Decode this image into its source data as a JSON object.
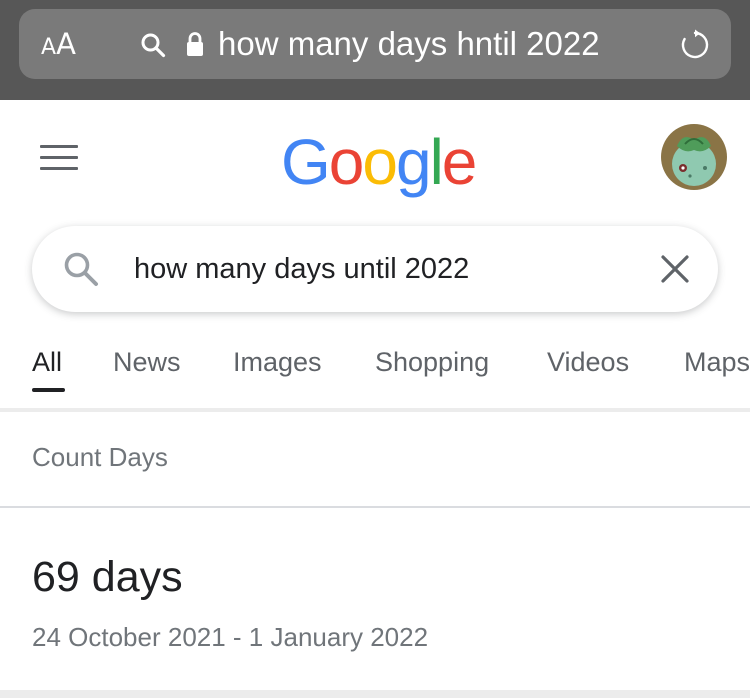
{
  "browser": {
    "aa_small": "A",
    "aa_big": "A",
    "url_text": "how many days hntil 2022"
  },
  "header": {
    "logo": [
      "G",
      "o",
      "o",
      "g",
      "l",
      "e"
    ],
    "logo_colors": [
      "#4285F4",
      "#EA4335",
      "#FBBC05",
      "#4285F4",
      "#34A853",
      "#EA4335"
    ]
  },
  "search": {
    "query": "how many days until 2022"
  },
  "tabs": [
    {
      "label": "All",
      "active": true
    },
    {
      "label": "News",
      "active": false
    },
    {
      "label": "Images",
      "active": false
    },
    {
      "label": "Shopping",
      "active": false
    },
    {
      "label": "Videos",
      "active": false
    },
    {
      "label": "Maps",
      "active": false
    }
  ],
  "result": {
    "header": "Count Days",
    "value": "69 days",
    "range": "24 October 2021 - 1 January 2022"
  },
  "colors": {
    "browser_bar": "#575757",
    "address_field": "#7a7a7a",
    "text_primary": "#202124",
    "text_secondary": "#70757a",
    "icon_gray": "#5f6368"
  }
}
